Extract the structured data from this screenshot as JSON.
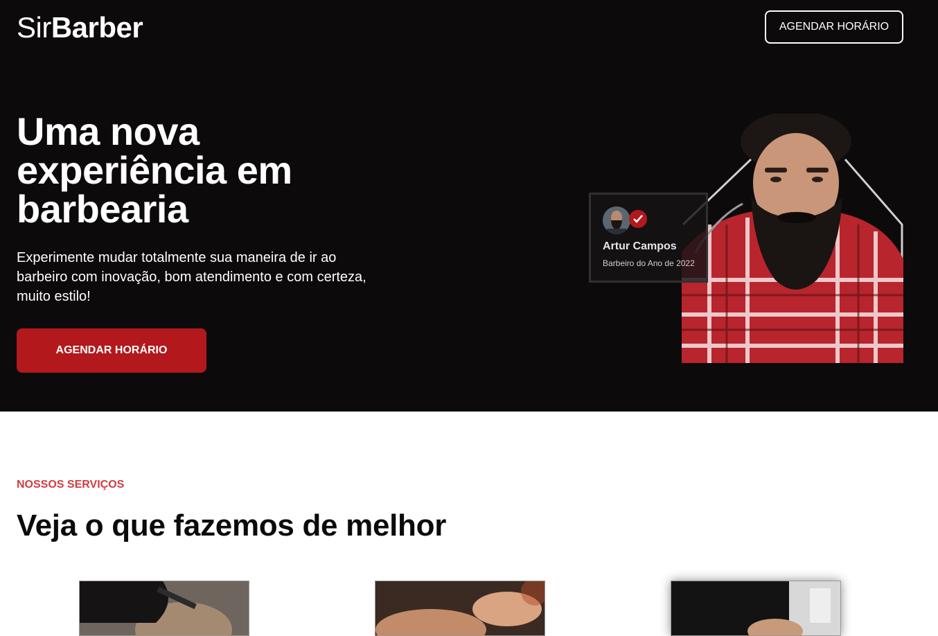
{
  "header": {
    "logo_light": "Sir",
    "logo_bold": "Barber",
    "cta_label": "AGENDAR HORÁRIO"
  },
  "hero": {
    "title": "Uma nova experiência em barbearia",
    "subtitle": "Experimente mudar totalmente sua maneira de ir ao barbeiro com inovação, bom atendimento e com certeza, muito estilo!",
    "cta_label": "AGENDAR HORÁRIO",
    "badge": {
      "name": "Artur Campos",
      "title": "Barbeiro do Ano de 2022",
      "verified_icon": "check-circle-icon"
    }
  },
  "services": {
    "eyebrow": "NOSSOS SERVIÇOS",
    "title": "Veja o que fazemos de melhor",
    "cards": [
      {
        "image": "haircut-photo"
      },
      {
        "image": "eyebrow-grooming-photo"
      },
      {
        "image": "beard-shave-photo"
      }
    ]
  },
  "colors": {
    "hero_bg": "#0d0a0b",
    "accent_red": "#b3181c",
    "eyebrow_red": "#d43a3f",
    "text_dark": "#0d0a0b"
  }
}
